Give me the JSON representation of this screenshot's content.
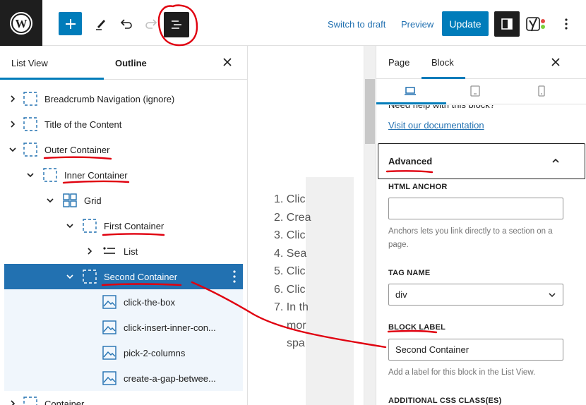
{
  "toolbar": {
    "switch_to_draft": "Switch to draft",
    "preview": "Preview",
    "update": "Update"
  },
  "list_view": {
    "tabs": [
      "List View",
      "Outline"
    ],
    "rows": [
      {
        "label": "Breadcrumb Navigation (ignore)",
        "icon": "container-icon"
      },
      {
        "label": "Title of the Content",
        "icon": "container-icon"
      },
      {
        "label": "Outer Container",
        "icon": "container-icon"
      },
      {
        "label": "Inner Container",
        "icon": "container-icon"
      },
      {
        "label": "Grid",
        "icon": "grid-icon"
      },
      {
        "label": "First Container",
        "icon": "container-icon"
      },
      {
        "label": "List",
        "icon": "list-icon"
      },
      {
        "label": "Second Container",
        "icon": "container-icon"
      },
      {
        "label": "click-the-box",
        "icon": "image-icon"
      },
      {
        "label": "click-insert-inner-con...",
        "icon": "image-icon"
      },
      {
        "label": "pick-2-columns",
        "icon": "image-icon"
      },
      {
        "label": "create-a-gap-betwee...",
        "icon": "image-icon"
      },
      {
        "label": "Container",
        "icon": "container-icon"
      }
    ]
  },
  "canvas": {
    "items": [
      "1. Clic",
      "2. Crea",
      "3. Clic",
      "4. Sea",
      "5. Clic",
      "6. Clic",
      "7. In th",
      "mor",
      "spa"
    ]
  },
  "sidebar": {
    "tabs": [
      "Page",
      "Block"
    ],
    "help_text": "Need help with this block?",
    "doc_link": "Visit our documentation",
    "advanced_title": "Advanced",
    "html_anchor_label": "HTML ANCHOR",
    "html_anchor_value": "",
    "anchor_help": "Anchors lets you link directly to a section on a page.",
    "tag_name_label": "TAG NAME",
    "tag_name_value": "div",
    "block_label_label": "BLOCK LABEL",
    "block_label_value": "Second Container",
    "block_label_help": "Add a label for this block in the List View.",
    "css_class_label": "ADDITIONAL CSS CLASS(ES)"
  },
  "colors": {
    "accent": "#007cba",
    "selected_row": "#2271b1",
    "annotation": "#e0000f"
  }
}
